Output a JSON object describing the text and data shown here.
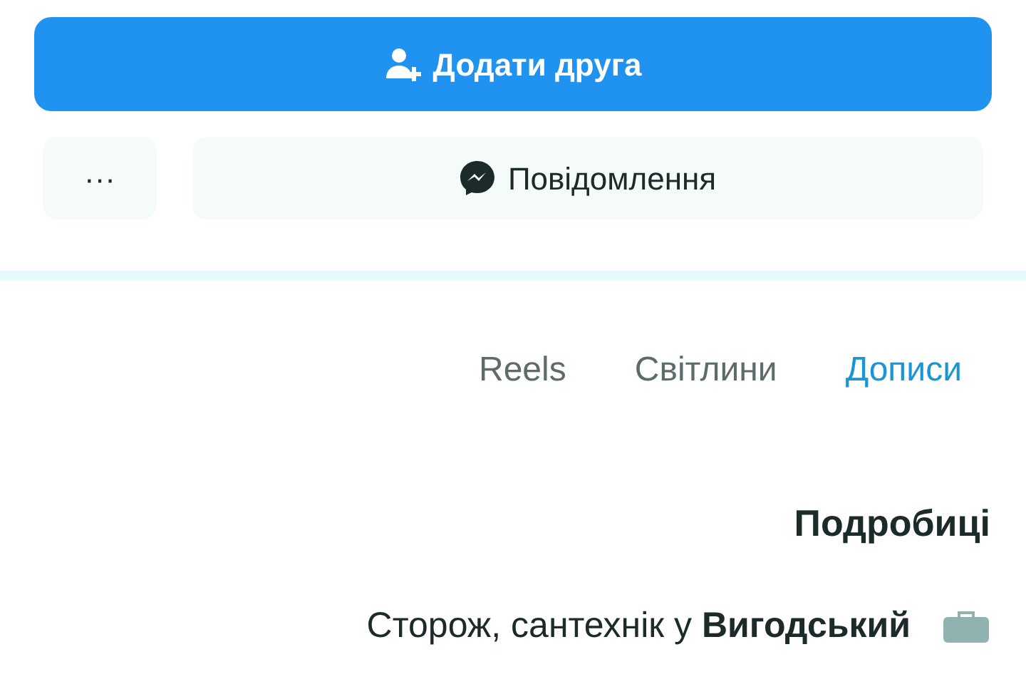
{
  "actions": {
    "add_friend": {
      "label": "Додати друга"
    },
    "message": {
      "label": "Повідомлення"
    },
    "more": {
      "label": "···"
    }
  },
  "tabs": [
    {
      "label": "Reels",
      "selected": false
    },
    {
      "label": "Світлини",
      "selected": false
    },
    {
      "label": "Дописи",
      "selected": true
    }
  ],
  "details": {
    "title": "Подробиці",
    "items": [
      {
        "kind": "work",
        "text": "Сторож, сантехнік у **Вигодський**"
      }
    ]
  }
}
